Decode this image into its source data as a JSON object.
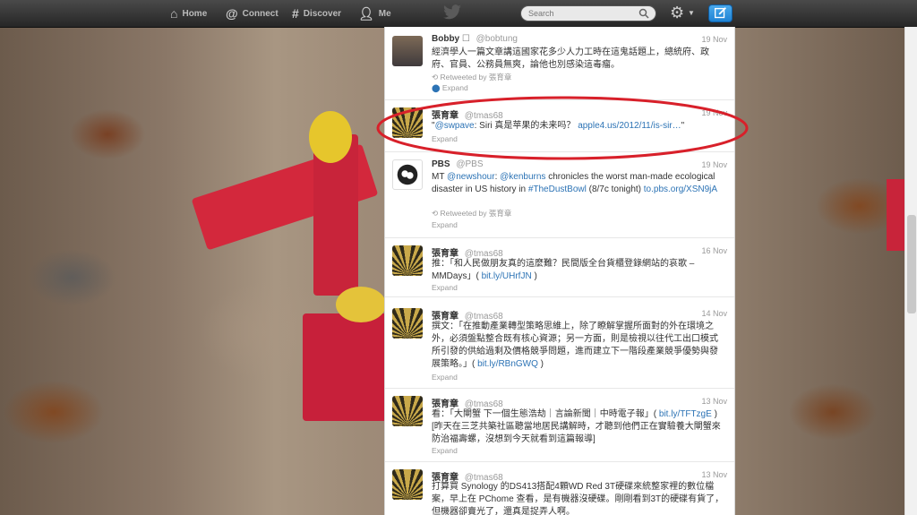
{
  "nav": {
    "home": "Home",
    "connect": "Connect",
    "discover": "Discover",
    "me": "Me",
    "search_placeholder": "Search"
  },
  "tweets": [
    {
      "name": "Bobby",
      "handle": "@bobtung",
      "time": "19 Nov",
      "text": "經濟學人一篇文章講這國家花多少人力工時在這鬼話題上，總統府、政府、官員、公務員無爽，論他也別感染這毒瘤。",
      "retweet": "Retweeted by 張育章",
      "action": "Expand"
    },
    {
      "name": "張育章",
      "handle": "@tmas68",
      "time": "19 Nov",
      "text_prefix": "\"",
      "mention": "@swpave",
      "text_mid": ": Siri 真是苹果的未来吗？ ",
      "url": "apple4.us/2012/11/is-sir…",
      "text_suffix": "\"",
      "action": "Expand"
    },
    {
      "name": "PBS",
      "handle": "@PBS",
      "time": "19 Nov",
      "text_a": "MT ",
      "mention_a": "@newshour",
      "text_b": ": ",
      "mention_b": "@kenburns",
      "text_c": " chronicles the worst man-made ecological disaster in US history in ",
      "hashtag": "#TheDustBowl",
      "text_d": " (8/7c tonight) ",
      "url": "to.pbs.org/XSN9jA",
      "retweet": "Retweeted by 張育章",
      "action": "Expand"
    },
    {
      "name": "張育章",
      "handle": "@tmas68",
      "time": "16 Nov",
      "text": "推：「和人民做朋友真的這麼難？民間版全台貨櫃登錄網站的哀歌 – MMDays」( ",
      "url": "bit.ly/UHrfJN",
      "text_end": " )",
      "action": "Expand"
    },
    {
      "name": "張育章",
      "handle": "@tmas68",
      "time": "14 Nov",
      "text": "撰文：「在推動產業轉型策略思維上，除了瞭解掌握所面對的外在環境之外，必須盤點整合既有核心資源；另一方面，則是檢視以往代工出口模式所引發的供給過剩及價格競爭問題，進而建立下一階段產業競爭優勢與發展策略。」( ",
      "url": "bit.ly/RBnGWQ",
      "text_end": " )",
      "action": "Expand"
    },
    {
      "name": "張育章",
      "handle": "@tmas68",
      "time": "13 Nov",
      "text": "看：「大閘蟹 下一個生態浩劫｜言論新聞｜中時電子報」( ",
      "url": "bit.ly/TFTzgE",
      "text_end": " ) [昨天在三芝共築社區聽當地居民講解時，才聽到他們正在實驗養大閘蟹來防治福壽螺，沒想到今天就看到這篇報導]",
      "action": "Expand"
    },
    {
      "name": "張育章",
      "handle": "@tmas68",
      "time": "13 Nov",
      "text": "打算買 Synology 的DS413搭配4顆WD Red 3T硬碟來統整家裡的數位檔案，早上在 PChome 查看，是有機器沒硬碟。剛剛看到3T的硬碟有貨了，但機器卻賣光了，還真是捉弄人啊。"
    }
  ]
}
